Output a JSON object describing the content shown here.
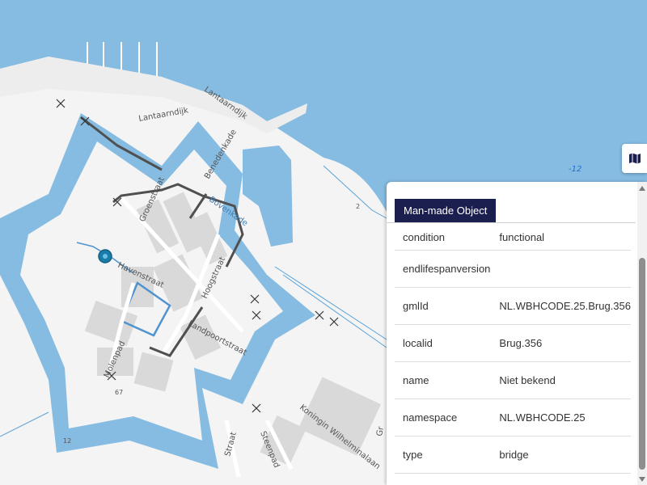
{
  "map": {
    "colors": {
      "water": "#86bce2",
      "land": "#f4f4f4",
      "building": "#d9d9d9",
      "road": "#ffffff",
      "track": "#505050",
      "highlight": "#4f93cf",
      "marker": "#1a7ca8"
    },
    "street_labels": [
      "Lantaarndijk",
      "Lantaarndijk",
      "Benedenkade",
      "Groenstraat",
      "Bovenkade",
      "Havenstraat",
      "Hoogstraat",
      "Landpoortstraat",
      "Molenpad",
      "Koningin Wilhelminalaan",
      "Steenpad",
      "Straat",
      "Gr"
    ],
    "depth_label": "-12",
    "small_labels": [
      "67",
      "12",
      "2"
    ],
    "marker_icon": "location-marker-icon"
  },
  "toolbar": {
    "layers_icon": "map-layers-icon"
  },
  "panel": {
    "tab_label": "Man-made Object",
    "rows": [
      {
        "key": "condition",
        "value": "functional"
      },
      {
        "key": "endlifespanversion",
        "value": ""
      },
      {
        "key": "gmlId",
        "value": "NL.WBHCODE.25.Brug.356"
      },
      {
        "key": "localid",
        "value": "Brug.356"
      },
      {
        "key": "name",
        "value": "Niet bekend"
      },
      {
        "key": "namespace",
        "value": "NL.WBHCODE.25"
      },
      {
        "key": "type",
        "value": "bridge"
      }
    ]
  }
}
